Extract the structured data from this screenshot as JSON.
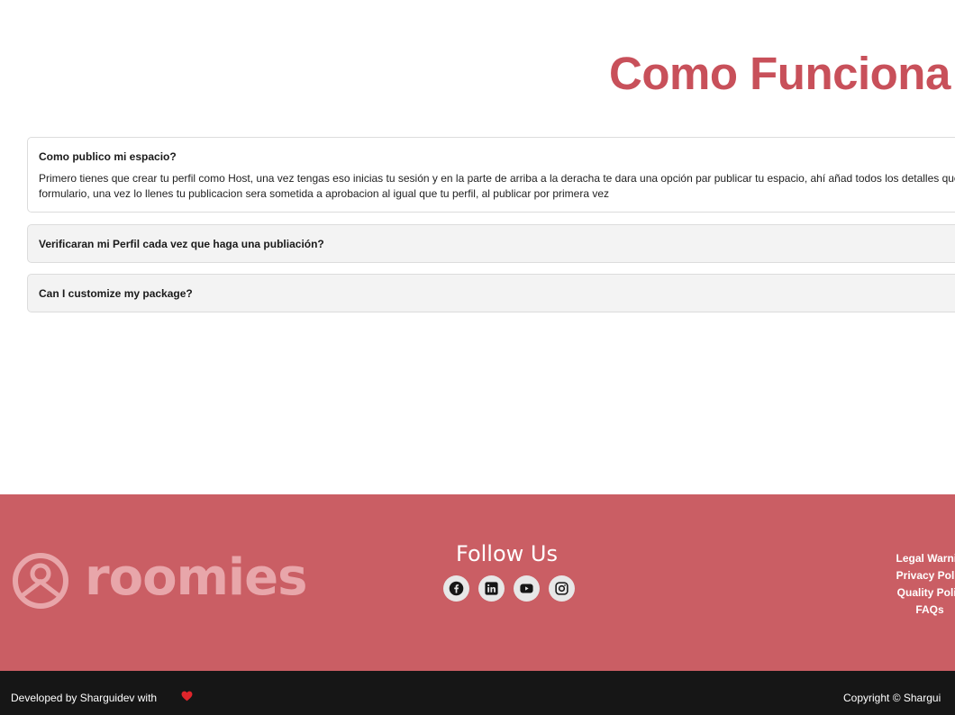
{
  "page": {
    "title": "Como Funciona"
  },
  "faq": [
    {
      "question": "Como publico mi espacio?",
      "answer": "Primero tienes que crear tu perfil como Host, una vez tengas eso inicias tu sesión y en la parte de arriba a la deracha te dara una opción par publicar tu espacio, ahí añad todos los detalles que el formulario, una vez lo llenes tu publicacion sera sometida a aprobacion al igual que tu perfil, al publicar por primera vez",
      "expanded": true
    },
    {
      "question": "Verificaran mi Perfil cada vez que haga una publiación?",
      "expanded": false
    },
    {
      "question": "Can I customize my package?",
      "expanded": false
    }
  ],
  "footer": {
    "logo_text": "roomies",
    "follow_title": "Follow Us",
    "social_icons": [
      "facebook-icon",
      "linkedin-icon",
      "youtube-icon",
      "instagram-icon"
    ],
    "links": [
      "Legal Warnin",
      "Privacy Polic",
      "Quality Polic",
      "FAQs"
    ],
    "bottom": {
      "developed_by": "Developed by Sharguidev with",
      "copyright": "Copyright © Shargui"
    }
  },
  "colors": {
    "accent": "#c8505a",
    "footer_bg": "#ca5e64",
    "bottom_bar_bg": "#161616",
    "heart": "#e0252b"
  }
}
